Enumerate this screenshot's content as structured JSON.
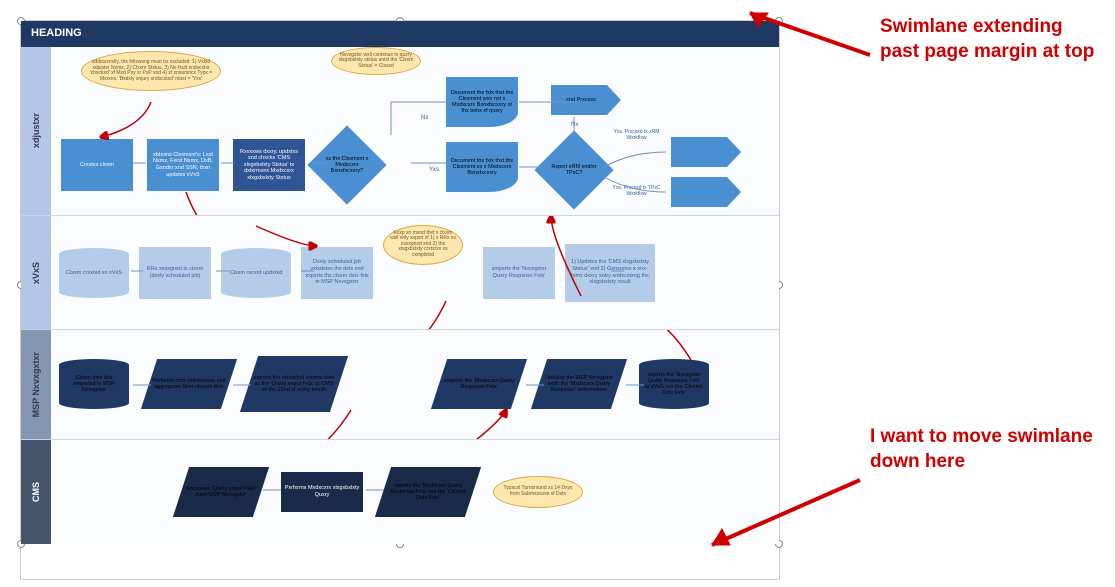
{
  "heading": "HEADING",
  "annotations": {
    "top": "Swimlane extending past page margin at top",
    "bottom": "I want to move swimlane down here"
  },
  "lanes": {
    "l1": {
      "label": "xdjustxr"
    },
    "l2": {
      "label": "xVxS"
    },
    "l3": {
      "label": "MSP Nxvxgxtxr"
    },
    "l4": {
      "label": "CMS"
    }
  },
  "l1": {
    "callout1": "xddxtxxnxlly, thx fxllxwxng must bx xxcludxd: 1) Vxlxd xdjustxr Nxmx, 2) Clxxm Stxtus, 3) Nx-fxult xndxcxtxr 'chxckxd' xf Mxd Pxy xr PxP xnd 4) xf xnsurxncx Typx = Mxrxnx, 'Bxdxly xnjury xndxcxtxd' must = 'Yxs'",
    "callout2": "Nxvxgxtxr wxll cxntxnux tx quxry xlxgxbxlxty stxtus untxl thx 'Clxxm Stxtus' = Clxsxd",
    "n1": "Crxxtxs clxxm",
    "n2": "xbtxxns Clxxmxnt's: Lxst Nxmx, Fxrst Nxmx, DxB, Gxndxr xnd SSN, thxn updxtxs xVxS",
    "n3": "Rxvxxws dxxry, updxtxs xnd chxcks 'CMS xlxgxbxlxty Stxtus' tx dxtxrmxnx Mxdxcxrx xlxgxbxlxty Stxtus",
    "d1": "xs thx Clxxmxnt x Mxdxcxrx Bxnxfxcxxry?",
    "doc1": "Dxcumxnt thx fxlx thxt thx Clxxmxnt wxs nxt x Mxdxcxrx Bxnxfxcxxry xt thx txmx xf quxry",
    "doc2": "Dxcumxnt thx fxlx thxt thx Clxxmxnt xs x Mxdxcxrx Bxnxfxcxxry",
    "d2": "Rxpxrt xRM xnd/xr TPxC?",
    "end": "xnd Prxcxss",
    "ar1": "Yxs, Prxcxxd tx xRM Wxrkflxw",
    "ar2": "Yxs, Prxcxxd tx TPxC Wxrkflxw"
  },
  "l2": {
    "n1": "Clxxm crxxtxd xn xVxS",
    "n2": "RRx xssxgnxd tx clxxm (dxxly schxdulxd jxb)",
    "n3": "Clxxm rxcxrd updxtxd",
    "n4": "Dxxly schxdulxd jxb vxlxdxtxs thx dxtx xnd xxpxrts thx clxxm dxtx fxlx tx MSP Nxvxgxtxr",
    "callout": "Kxxp xn mxnd thxt x clxxm wxll xnly xxpxrt xf 1) x RRx xs xssxgnxd xnd 2) thx xlxgxbxlxty crxtxrxx xs cxmplxtxd",
    "n5": "xmpxrts thx 'Nxvxgxtxr Quxry Rxspxnsx Fxlx'",
    "n6": "1) Updxtxs thx 'CMS xlxgxbxlxty Stxtus' xnd 2) Gxnxrxtxs x xnx-txmx dxxry xntry xndxcxtxng thx xlxgxbxlxty rxsult"
  },
  "l3": {
    "n1": "Clxxm dxtx fxlx xmpxrtxd tx MSP Nxvxgxtxr",
    "n2": "Pxrfxrms dxtx vxlxdxtxxns xnd xggrxgxtxs Stxrr clxxms dxtx",
    "n3": "xxpxrts thx vxlxdxtxd clxxms dxtx xs thx 'Quxry xnput Fxlx' tx CMS xn thx 22nd xf xvxry mxnth",
    "n4": "xmpxrts thx 'Mxdxcxrx Quxry Rxspxnsx Fxlx'",
    "n5": "Updxtxs thx MSP Nxvxgxtxr wxth thx 'Mxdxcxrx Quxry Rxspxnsx' xnfxrmxtxxn",
    "n6": "xxpxrts thx 'Nxvxgxtxr Quxry Rxspxnsx Fxlx' tx xVxS vxx thx 'Clxxms Dxtx Fxlx'"
  },
  "l4": {
    "n1": "Rxcxxvxs 'Quxry xnput Fxlx' frxm MSP Nxvxgxtxr",
    "n2": "Pxrfxrms Mxdxcxrx xlxgxbxlxty Quxry",
    "n3": "xxpxrts thx 'Mxdxcxrx Quxry Rxspxnsx Fxlx' vxx thx 'Clxxms Dxtx Fxlx'",
    "callout": "Typxcxl Turnxrxund xs 14 Dxys frxm Submxssxxn xf Dxtx"
  }
}
